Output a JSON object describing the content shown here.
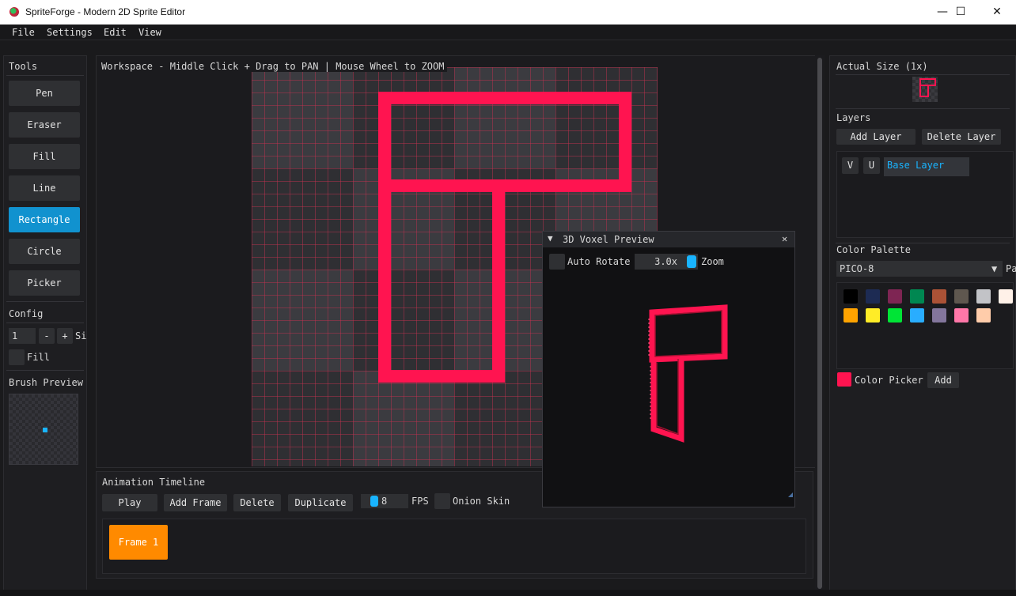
{
  "window": {
    "title": "SpriteForge - Modern 2D Sprite Editor",
    "minimize": "—",
    "maximize": "☐",
    "close": "✕"
  },
  "menu": [
    "File",
    "Settings",
    "Edit",
    "View"
  ],
  "tools": {
    "title": "Tools",
    "items": [
      "Pen",
      "Eraser",
      "Fill",
      "Line",
      "Rectangle",
      "Circle",
      "Picker"
    ],
    "active": "Rectangle"
  },
  "config": {
    "title": "Config",
    "size_value": "1",
    "minus": "-",
    "plus": "+",
    "size_label": "Si",
    "fill_label": "Fill"
  },
  "brush_preview": {
    "title": "Brush Preview"
  },
  "workspace": {
    "title": "Workspace - Middle Click + Drag to PAN | Mouse Wheel to ZOOM"
  },
  "timeline": {
    "title": "Animation Timeline",
    "play": "Play",
    "add_frame": "Add Frame",
    "delete": "Delete",
    "duplicate": "Duplicate",
    "fps_value": "8",
    "fps_label": "FPS",
    "onion_label": "Onion Skin",
    "frames": [
      "Frame 1"
    ]
  },
  "voxel": {
    "title": "3D Voxel Preview",
    "collapse": "▼",
    "close": "✕",
    "auto_rotate_label": "Auto Rotate",
    "zoom_value": "3.0x",
    "zoom_label": "Zoom"
  },
  "right": {
    "actual_size_title": "Actual Size (1x)",
    "layers_title": "Layers",
    "add_layer": "Add Layer",
    "delete_layer": "Delete Layer",
    "layer": {
      "v": "V",
      "u": "U",
      "name": "Base Layer"
    },
    "palette_title": "Color Palette",
    "palette_name": "PICO-8",
    "palette_dropdown": "▼",
    "palette_suffix": "Pa",
    "palette_colors": [
      "#000000",
      "#1d2b53",
      "#7e2553",
      "#008751",
      "#ab5236",
      "#5f574f",
      "#c2c3c7",
      "#fff1e8",
      "#ffa300",
      "#ffec27",
      "#00e436",
      "#29adff",
      "#83769c",
      "#ff77a8",
      "#ffccaa"
    ],
    "color_picker_label": "Color Picker",
    "color_picker_value": "#ff1450",
    "add": "Add"
  },
  "colors": {
    "accent": "#1192cf",
    "stroke": "#ff1450",
    "frame": "#ff8a00"
  }
}
